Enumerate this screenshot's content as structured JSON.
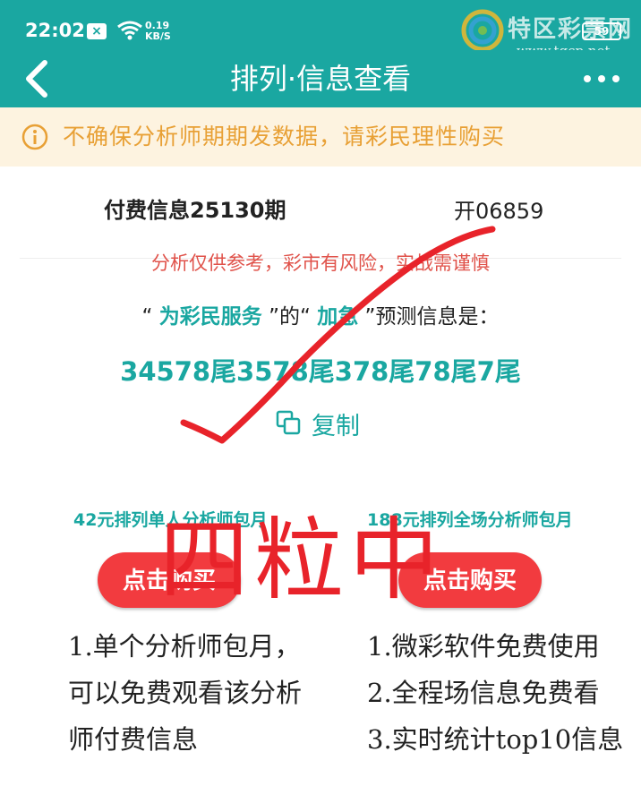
{
  "status_bar": {
    "time": "22:02",
    "close_badge": "×",
    "speed_value": "0.19",
    "speed_unit": "KB/S",
    "battery": "59"
  },
  "watermark": {
    "name": "特区彩票网",
    "url": "www.tqcp.net"
  },
  "nav": {
    "title": "排列·信息查看"
  },
  "notice": {
    "text": "不确保分析师期期发数据，请彩民理性购买"
  },
  "info": {
    "title": "付费信息25130期",
    "draw_result": "开06859",
    "risk_text": "分析仅供参考，彩市有风险，实战需谨慎",
    "predict_q1": "“ ",
    "predict_name": "为彩民服务",
    "predict_mid": " ”的“ ",
    "predict_type": "加急",
    "predict_end": " ”预测信息是：",
    "numbers": "34578尾3578尾378尾78尾7尾",
    "copy_label": "复制"
  },
  "plans": [
    {
      "title": "42元排列单人分析师包月",
      "button": "点击购买",
      "desc": [
        "1.单个分析师包月，",
        "可以免费观看该分析",
        "师付费信息"
      ]
    },
    {
      "title": "188元排列全场分析师包月",
      "button": "点击购买",
      "desc": [
        "1.微彩软件免费使用",
        "2.全程场信息免费看",
        "3.实时统计top10信息"
      ]
    }
  ],
  "handwriting": {
    "text": "四粒中",
    "color": "#e8232a"
  },
  "colors": {
    "brand": "#1aa7a1",
    "notice_bg": "#fdf3e0",
    "notice_text": "#e8a035",
    "buy_button": "#f23b3f",
    "risk_text": "#e0524a"
  }
}
